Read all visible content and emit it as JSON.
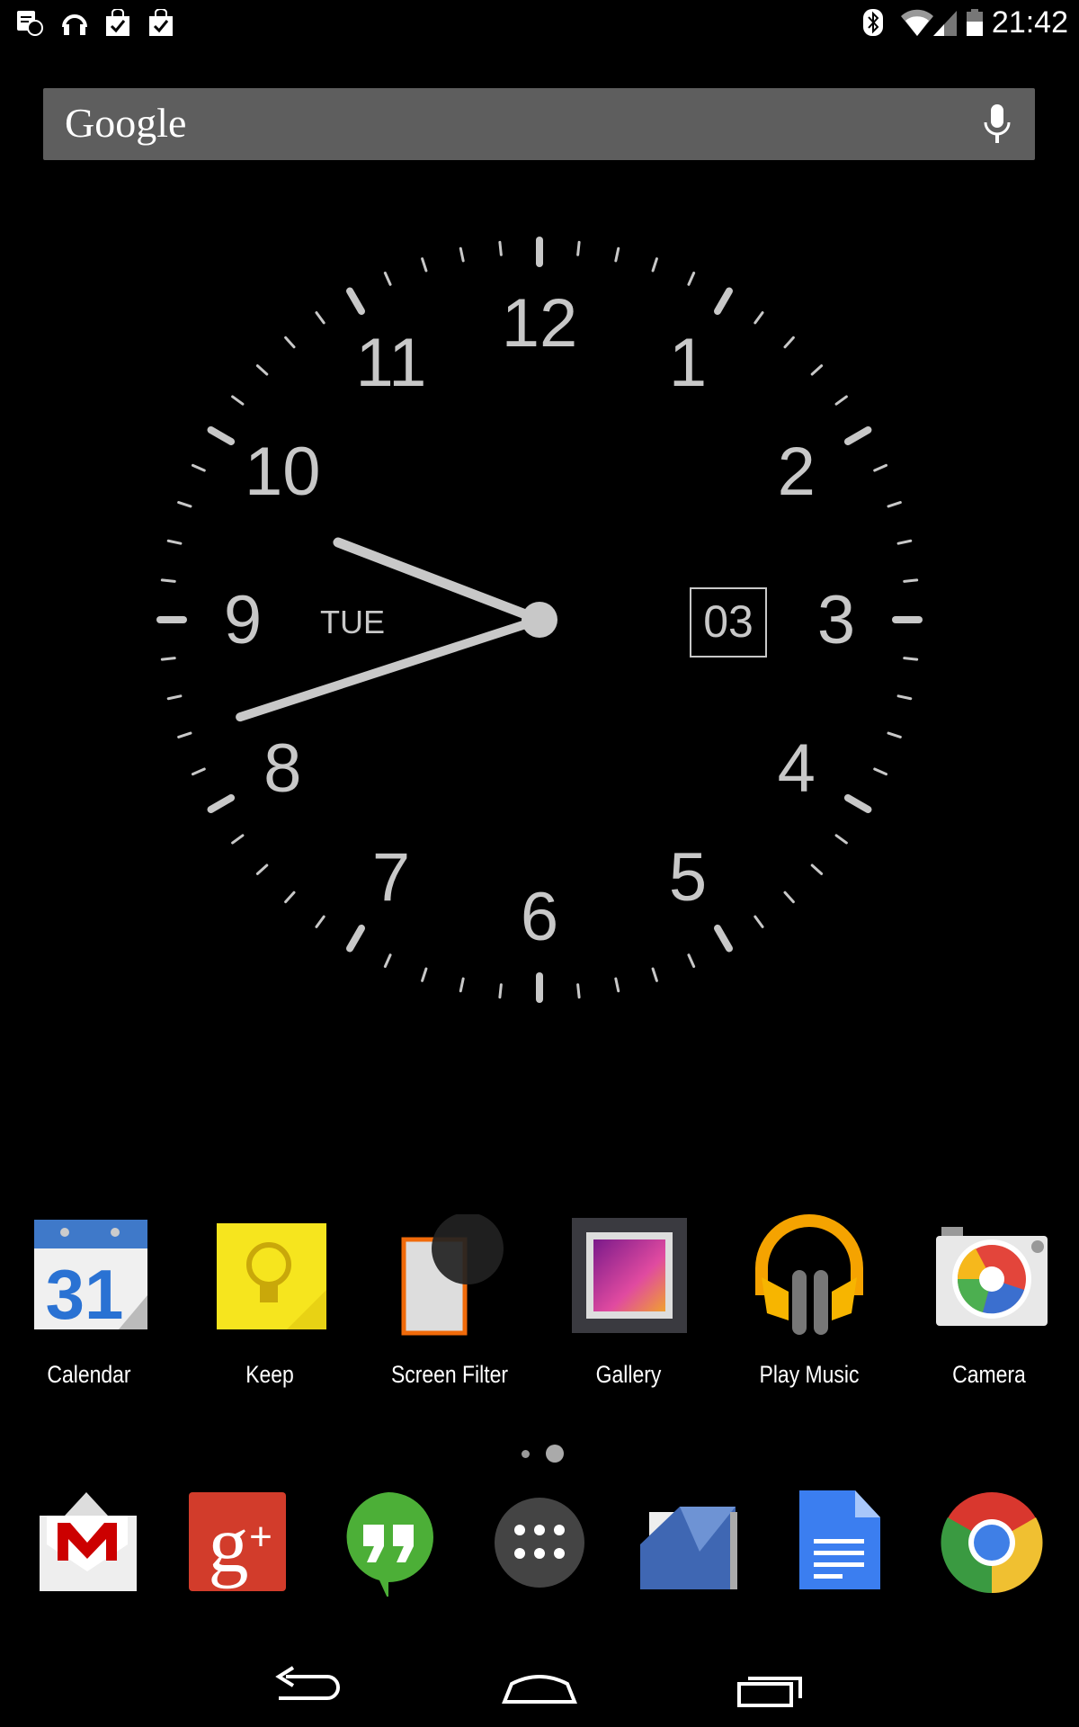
{
  "status_bar": {
    "left_icons": [
      "notes-pin-icon",
      "headphones-icon",
      "shopping-bag-check-icon",
      "shopping-bag-check-icon"
    ],
    "right_icons": [
      "bluetooth-icon",
      "wifi-icon",
      "cell-signal-icon",
      "battery-icon"
    ],
    "time": "21:42"
  },
  "search": {
    "logo": "Google",
    "mic_icon": "mic-icon"
  },
  "clock": {
    "numbers": [
      "12",
      "1",
      "2",
      "3",
      "4",
      "5",
      "6",
      "7",
      "8",
      "9",
      "10",
      "11"
    ],
    "day": "TUE",
    "date": "03",
    "hour": 21,
    "minute": 42
  },
  "apps": [
    {
      "label": "Calendar",
      "icon": "calendar-icon"
    },
    {
      "label": "Keep",
      "icon": "keep-icon"
    },
    {
      "label": "Screen Filter",
      "icon": "screen-filter-icon"
    },
    {
      "label": "Gallery",
      "icon": "gallery-icon"
    },
    {
      "label": "Play Music",
      "icon": "play-music-icon"
    },
    {
      "label": "Camera",
      "icon": "camera-icon"
    }
  ],
  "calendar_number": "31",
  "page_indicator": {
    "pages": 2,
    "current": 2
  },
  "dock": [
    "gmail-icon",
    "google-plus-icon",
    "hangouts-icon",
    "app-drawer-icon",
    "play-books-icon",
    "docs-icon",
    "chrome-icon"
  ],
  "nav": [
    "back-icon",
    "home-icon",
    "recents-icon"
  ],
  "colors": {
    "search_bg": "#5e5e5e",
    "clock": "#c8c8c8"
  }
}
